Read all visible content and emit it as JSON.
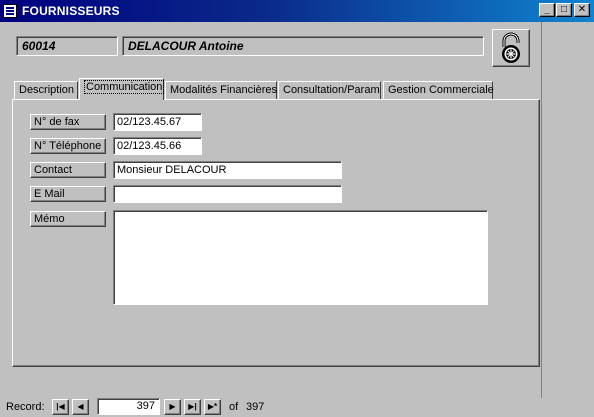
{
  "window": {
    "title": "FOURNISSEURS",
    "minimize_glyph": "_",
    "maximize_glyph": "□",
    "close_glyph": "✕"
  },
  "header": {
    "code": "60014",
    "name": "DELACOUR Antoine"
  },
  "tabs": [
    {
      "label": "Description",
      "active": false
    },
    {
      "label": "Communication",
      "active": true
    },
    {
      "label": "Modalités Financières",
      "active": false
    },
    {
      "label": "Consultation/Param",
      "active": false
    },
    {
      "label": "Gestion Commerciale",
      "active": false
    }
  ],
  "form": {
    "fax": {
      "label": "N° de fax",
      "value": "02/123.45.67"
    },
    "phone": {
      "label": "N° Téléphone",
      "value": "02/123.45.66"
    },
    "contact": {
      "label": "Contact",
      "value": "Monsieur DELACOUR"
    },
    "email": {
      "label": "E Mail",
      "value": ""
    },
    "memo": {
      "label": "Mémo",
      "value": ""
    }
  },
  "navigation": {
    "record_label": "Record:",
    "current": "397",
    "of_label": "of",
    "total": "397"
  },
  "icons": {
    "lock": "padlock-icon",
    "first": "first-record-icon",
    "prev": "previous-record-icon",
    "next": "next-record-icon",
    "last": "last-record-icon",
    "new": "new-record-icon"
  },
  "colors": {
    "titlebar": "#000080",
    "face": "#c0c0c0",
    "field": "#ffffff"
  }
}
